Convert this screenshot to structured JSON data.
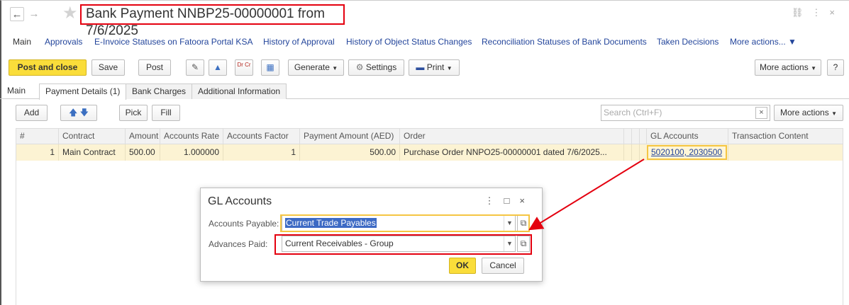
{
  "window": {
    "title": "Bank Payment NNBP25-00000001 from 7/6/2025"
  },
  "nav_links": {
    "main": "Main",
    "items": [
      "Approvals",
      "E-Invoice Statuses on Fatoora Portal KSA",
      "History of Approval",
      "History of Object Status Changes",
      "Reconciliation Statuses of Bank Documents",
      "Taken Decisions",
      "More actions... ▼"
    ]
  },
  "toolbar": {
    "post_and_close": "Post and close",
    "save": "Save",
    "post": "Post",
    "dr_cr": "Dr Cr",
    "generate": "Generate",
    "settings": "Settings",
    "print": "Print",
    "more_actions": "More actions",
    "help": "?"
  },
  "tabs": [
    "Main",
    "Payment Details (1)",
    "Bank Charges",
    "Additional Information"
  ],
  "table_toolbar": {
    "add": "Add",
    "pick": "Pick",
    "fill": "Fill",
    "search_placeholder": "Search (Ctrl+F)",
    "clear": "×",
    "more_actions": "More actions"
  },
  "table": {
    "columns": [
      "#",
      "Contract",
      "Amount",
      "Accounts Rate",
      "Accounts Factor",
      "Payment Amount (AED)",
      "Order",
      "GL Accounts",
      "Transaction Content"
    ],
    "rows": [
      {
        "num": "1",
        "contract": "Main Contract",
        "amount": "500.00",
        "rate": "1.000000",
        "factor": "1",
        "payment_amount": "500.00",
        "order": "Purchase Order NNPO25-00000001 dated 7/6/2025...",
        "gl_accounts": "5020100, 2030500",
        "transaction_content": ""
      }
    ]
  },
  "dialog": {
    "title": "GL Accounts",
    "accounts_payable_label": "Accounts Payable:",
    "accounts_payable_value": "Current Trade Payables",
    "advances_paid_label": "Advances Paid:",
    "advances_paid_value": "Current Receivables - Group",
    "ok": "OK",
    "cancel": "Cancel"
  },
  "colors": {
    "accent_yellow": "#fadd3a",
    "highlight_red": "#e4000f",
    "link_blue": "#23459b",
    "selected_row": "#fcf3d3"
  }
}
